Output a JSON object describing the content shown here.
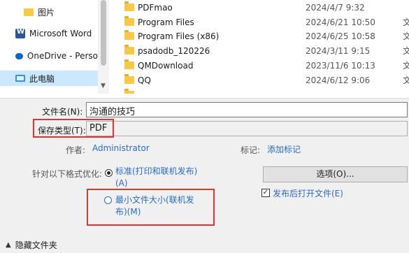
{
  "nav": {
    "items": [
      {
        "label": "图片",
        "icon": "folder-icon"
      },
      {
        "label": "Microsoft Word",
        "icon": "word-icon"
      },
      {
        "label": "OneDrive - Perso",
        "icon": "onedrive-icon"
      },
      {
        "label": "此电脑",
        "icon": "computer-icon"
      }
    ]
  },
  "files": [
    {
      "name": "PDFmao",
      "date": "2024/4/7 9:32",
      "type": ""
    },
    {
      "name": "Program Files",
      "date": "2024/6/21 10:50",
      "type": "文"
    },
    {
      "name": "Program Files (x86)",
      "date": "2024/6/25 10:58",
      "type": "文"
    },
    {
      "name": "psadodb_120226",
      "date": "2024/3/11 9:15",
      "type": "文"
    },
    {
      "name": "QMDownload",
      "date": "2023/11/6 10:13",
      "type": "文"
    },
    {
      "name": "QQ",
      "date": "2024/6/12 9:06",
      "type": "文"
    },
    {
      "name": "",
      "date": "",
      "type": ""
    }
  ],
  "form": {
    "filename_label": "文件名(N):",
    "filename_value": "沟通的技巧",
    "savetype_label": "保存类型(T):",
    "savetype_value": "PDF"
  },
  "meta": {
    "author_label": "作者:",
    "author_value": "Administrator",
    "tags_label": "标记:",
    "tags_value": "添加标记"
  },
  "optimize": {
    "label": "针对以下格式优化:",
    "option_standard_line1": "标准(打印和联机发布)",
    "option_standard_line2": "(A)",
    "option_min_line1": "最小文件大小(联机发",
    "option_min_line2": "布)(M)"
  },
  "options_button": "选项(O)...",
  "open_after_publish": "发布后打开文件(E)",
  "hide_folders": "隐藏文件夹",
  "colors": {
    "accent_red": "#e53131",
    "link_blue": "#2a6bc7"
  }
}
